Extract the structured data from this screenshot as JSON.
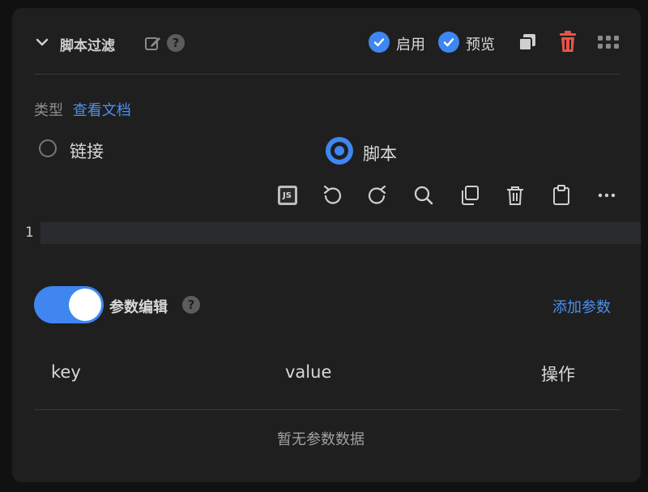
{
  "header": {
    "title": "脚本过滤",
    "enable_label": "启用",
    "preview_label": "预览",
    "help_mark": "?"
  },
  "type_section": {
    "label": "类型",
    "docs_link": "查看文档",
    "options": [
      {
        "label": "链接",
        "selected": false
      },
      {
        "label": "脚本",
        "selected": true
      }
    ]
  },
  "toolbar": {
    "items": [
      "js-icon",
      "undo-icon",
      "redo-icon",
      "search-icon",
      "copy-icon",
      "delete-icon",
      "clipboard-icon",
      "more-icon"
    ],
    "js_badge": "JS"
  },
  "editor": {
    "line_numbers": [
      "1"
    ],
    "content": ""
  },
  "params": {
    "toggle_on": true,
    "label": "参数编辑",
    "help_mark": "?",
    "add_label": "添加参数",
    "columns": [
      "key",
      "value",
      "操作"
    ],
    "empty_text": "暂无参数数据"
  },
  "colors": {
    "accent": "#3f86f0",
    "danger": "#e5544b",
    "card_bg": "#1f1f1f",
    "page_bg": "#111111"
  }
}
